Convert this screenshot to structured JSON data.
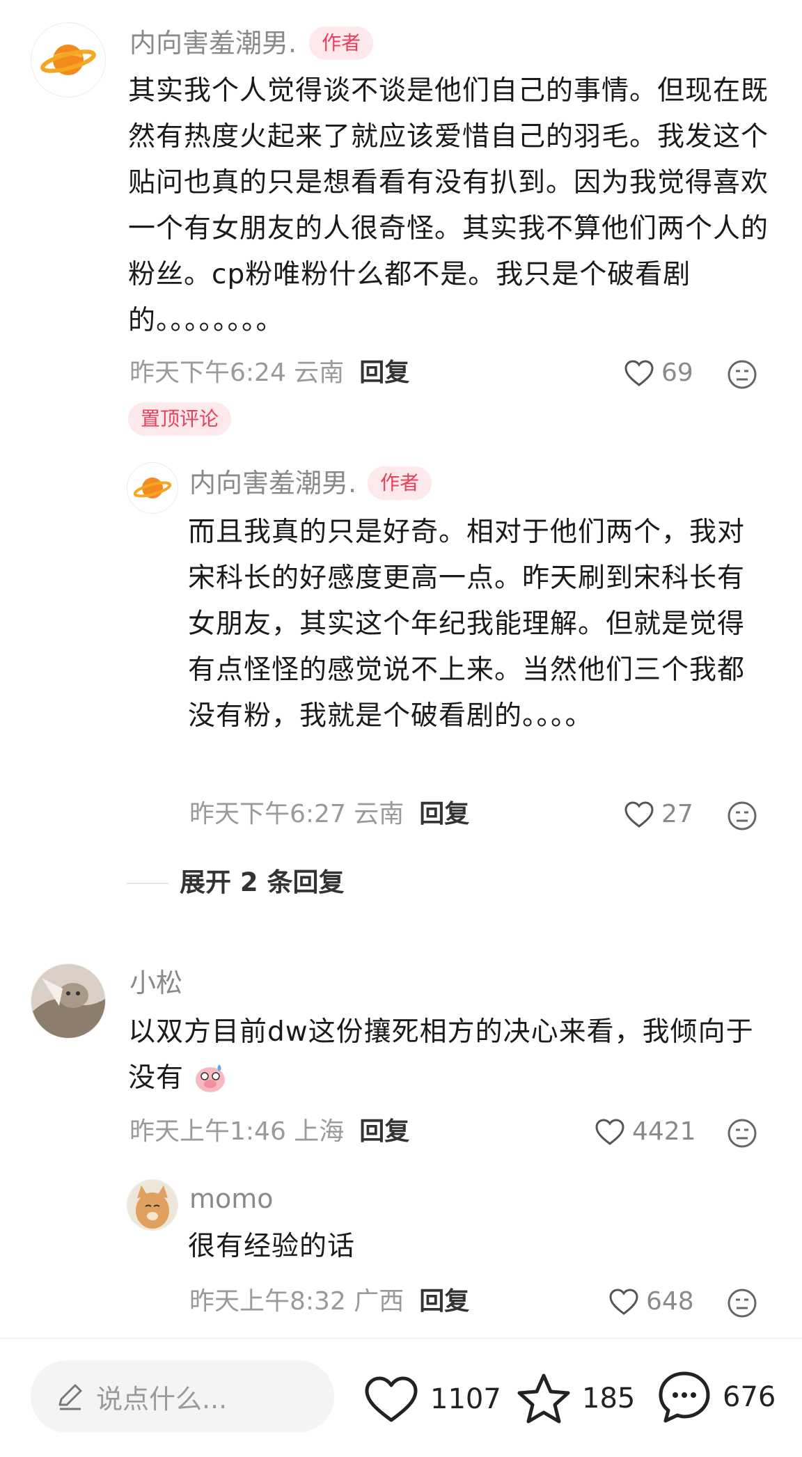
{
  "comments": [
    {
      "author": "内向害羞潮男.",
      "badge": "作者",
      "text": "其实我个人觉得谈不谈是他们自己的事情。但现在既然有热度火起来了就应该爱惜自己的羽毛。我发这个贴问也真的只是想看看有没有扒到。因为我觉得喜欢一个有女朋友的人很奇怪。其实我不算他们两个人的粉丝。cp粉唯粉什么都不是。我只是个破看剧的。。。。。。。。",
      "time": "昨天下午6:24 云南",
      "reply_label": "回复",
      "likes": "69",
      "pinned_label": "置顶评论",
      "reply": {
        "author": "内向害羞潮男.",
        "badge": "作者",
        "text": "而且我真的只是好奇。相对于他们两个，我对宋科长的好感度更高一点。昨天刷到宋科长有女朋友，其实这个年纪我能理解。但就是觉得有点怪怪的感觉说不上来。当然他们三个我都没有粉，我就是个破看剧的。。。。",
        "time": "昨天下午6:27 云南",
        "reply_label": "回复",
        "likes": "27"
      },
      "expand_label": "展开 2 条回复"
    },
    {
      "author": "小松",
      "text": "以双方目前dw这份攘死相方的决心来看，我倾向于没有",
      "time": "昨天上午1:46 上海",
      "reply_label": "回复",
      "likes": "4421",
      "reply": {
        "author": "momo",
        "text": "很有经验的话",
        "time": "昨天上午8:32 广西",
        "reply_label": "回复",
        "likes": "648"
      }
    }
  ],
  "bottom_bar": {
    "input_placeholder": "说点什么...",
    "likes": "1107",
    "favorites": "185",
    "comments": "676"
  },
  "icons": {
    "heart": "heart-icon",
    "dislike": "dislike-face-icon",
    "pencil": "pencil-icon",
    "star": "star-icon",
    "chat": "chat-bubble-icon",
    "emoji": "pig-sweat-emoji"
  },
  "colors": {
    "badge_bg": "#fde9ec",
    "badge_text": "#e8405a",
    "meta": "#9a9a9a"
  }
}
